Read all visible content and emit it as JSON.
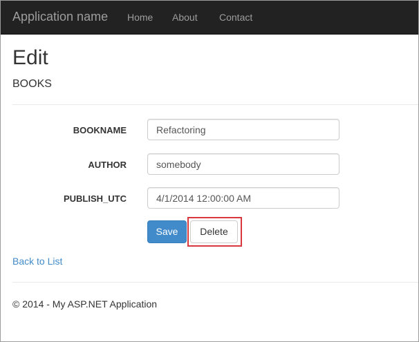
{
  "navbar": {
    "brand": "Application name",
    "links": [
      {
        "label": "Home"
      },
      {
        "label": "About"
      },
      {
        "label": "Contact"
      }
    ]
  },
  "page": {
    "title": "Edit",
    "subtitle": "BOOKS"
  },
  "form": {
    "fields": [
      {
        "label": "BOOKNAME",
        "value": "Refactoring"
      },
      {
        "label": "AUTHOR",
        "value": "somebody"
      },
      {
        "label": "PUBLISH_UTC",
        "value": "4/1/2014 12:00:00 AM"
      }
    ],
    "save_label": "Save",
    "delete_label": "Delete"
  },
  "links": {
    "back_to_list": "Back to List"
  },
  "footer": {
    "text": "© 2014 - My ASP.NET Application"
  },
  "colors": {
    "navbar_bg": "#222222",
    "nav_text": "#9d9d9d",
    "primary": "#428bca",
    "highlight": "#d9363e"
  }
}
